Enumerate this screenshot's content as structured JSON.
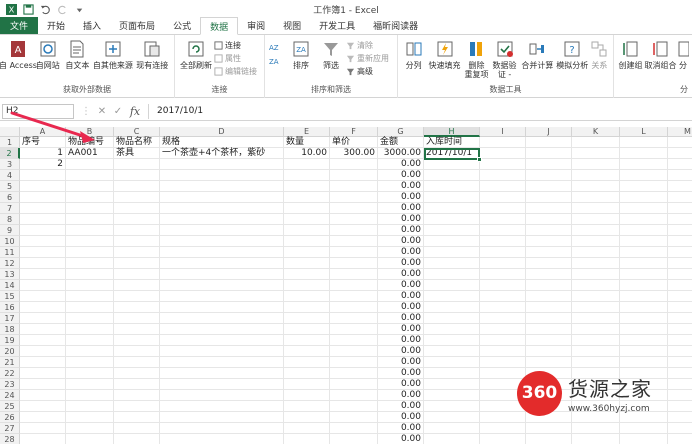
{
  "window": {
    "title": "工作簿1 - Excel"
  },
  "tabs": [
    {
      "label": "文件",
      "kind": "file"
    },
    {
      "label": "开始"
    },
    {
      "label": "插入"
    },
    {
      "label": "页面布局"
    },
    {
      "label": "公式"
    },
    {
      "label": "数据",
      "active": true
    },
    {
      "label": "审阅"
    },
    {
      "label": "视图"
    },
    {
      "label": "开发工具"
    },
    {
      "label": "福昕阅读器"
    }
  ],
  "ribbon": {
    "group_external": {
      "label": "获取外部数据",
      "access": "自 Access",
      "web": "自网站",
      "text": "自文本",
      "other": "自其他来源",
      "existing": "现有连接"
    },
    "group_connections": {
      "label": "连接",
      "refresh_all": "全部刷新",
      "connections": "连接",
      "properties": "属性",
      "edit_links": "编辑链接"
    },
    "group_sort": {
      "label": "排序和筛选",
      "sort": "排序",
      "filter": "筛选",
      "clear": "清除",
      "reapply": "重新应用",
      "advanced": "高级"
    },
    "group_tools": {
      "label": "数据工具",
      "split": "分列",
      "flash_fill": "快速填充",
      "remove_dup_1": "删除",
      "remove_dup_2": "重复项",
      "validation_1": "数据验",
      "validation_2": "证 -",
      "consolidate": "合并计算",
      "whatif": "模拟分析",
      "relations": "关系"
    },
    "group_outline": {
      "label": "分",
      "group": "创建组",
      "ungroup": "取消组合",
      "subtotal": "分"
    }
  },
  "formula_bar": {
    "name_box": "H2",
    "cancel": "✕",
    "enter": "✓",
    "fx": "fx",
    "content": "2017/10/1"
  },
  "columns": [
    "A",
    "B",
    "C",
    "D",
    "E",
    "F",
    "G",
    "H",
    "I",
    "J",
    "K",
    "L",
    "M"
  ],
  "rows": [
    "1",
    "2",
    "3",
    "4",
    "5",
    "6",
    "7",
    "8",
    "9",
    "10",
    "11",
    "12",
    "13",
    "14",
    "15",
    "16",
    "17",
    "18",
    "19",
    "20",
    "21",
    "22",
    "23",
    "24",
    "25",
    "26",
    "27",
    "28"
  ],
  "headers_row": [
    "序号",
    "物品编号",
    "物品名称",
    "规格",
    "数量",
    "单价",
    "金额",
    "入库时间"
  ],
  "row2": [
    "1",
    "AA001",
    "茶具",
    "一个茶壶+4个茶杯，紫砂",
    "10.00",
    "300.00",
    "3000.00",
    "2017/10/1"
  ],
  "row3_a": "2",
  "g_zero": "0.00",
  "selected": {
    "col": "H",
    "row": "2"
  },
  "watermark": {
    "logo": "360",
    "name": "货源之家",
    "url": "www.360hyzj.com"
  },
  "colors": {
    "accent": "#217346",
    "arrow": "#e8284f",
    "logo": "#e32b2b"
  }
}
